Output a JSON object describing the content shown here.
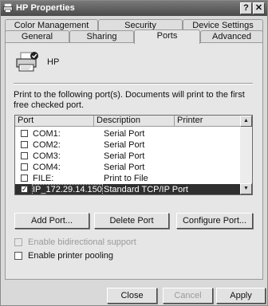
{
  "window": {
    "title": "HP Properties",
    "help_glyph": "?",
    "close_glyph": "✕"
  },
  "tabs": {
    "row1": [
      "Color Management",
      "Security",
      "Device Settings"
    ],
    "row2": [
      "General",
      "Sharing",
      "Ports",
      "Advanced"
    ],
    "active": "Ports"
  },
  "printer": {
    "name": "HP"
  },
  "instructions": "Print to the following port(s). Documents will print to the first free checked port.",
  "port_list": {
    "columns": [
      "Port",
      "Description",
      "Printer"
    ],
    "rows": [
      {
        "port": "COM1:",
        "description": "Serial Port",
        "checked": false,
        "selected": false
      },
      {
        "port": "COM2:",
        "description": "Serial Port",
        "checked": false,
        "selected": false
      },
      {
        "port": "COM3:",
        "description": "Serial Port",
        "checked": false,
        "selected": false
      },
      {
        "port": "COM4:",
        "description": "Serial Port",
        "checked": false,
        "selected": false
      },
      {
        "port": "FILE:",
        "description": "Print to File",
        "checked": false,
        "selected": false
      },
      {
        "port": "IP_172.29.14.150",
        "description": "Standard TCP/IP Port",
        "checked": true,
        "selected": true
      }
    ]
  },
  "port_buttons": {
    "add": "Add Port...",
    "delete": "Delete Port",
    "configure": "Configure Port..."
  },
  "options": {
    "bidirectional": {
      "label": "Enable bidirectional support",
      "checked": false,
      "enabled": false
    },
    "pooling": {
      "label": "Enable printer pooling",
      "checked": false,
      "enabled": true
    }
  },
  "footer": {
    "close": "Close",
    "cancel": "Cancel",
    "apply": "Apply"
  }
}
